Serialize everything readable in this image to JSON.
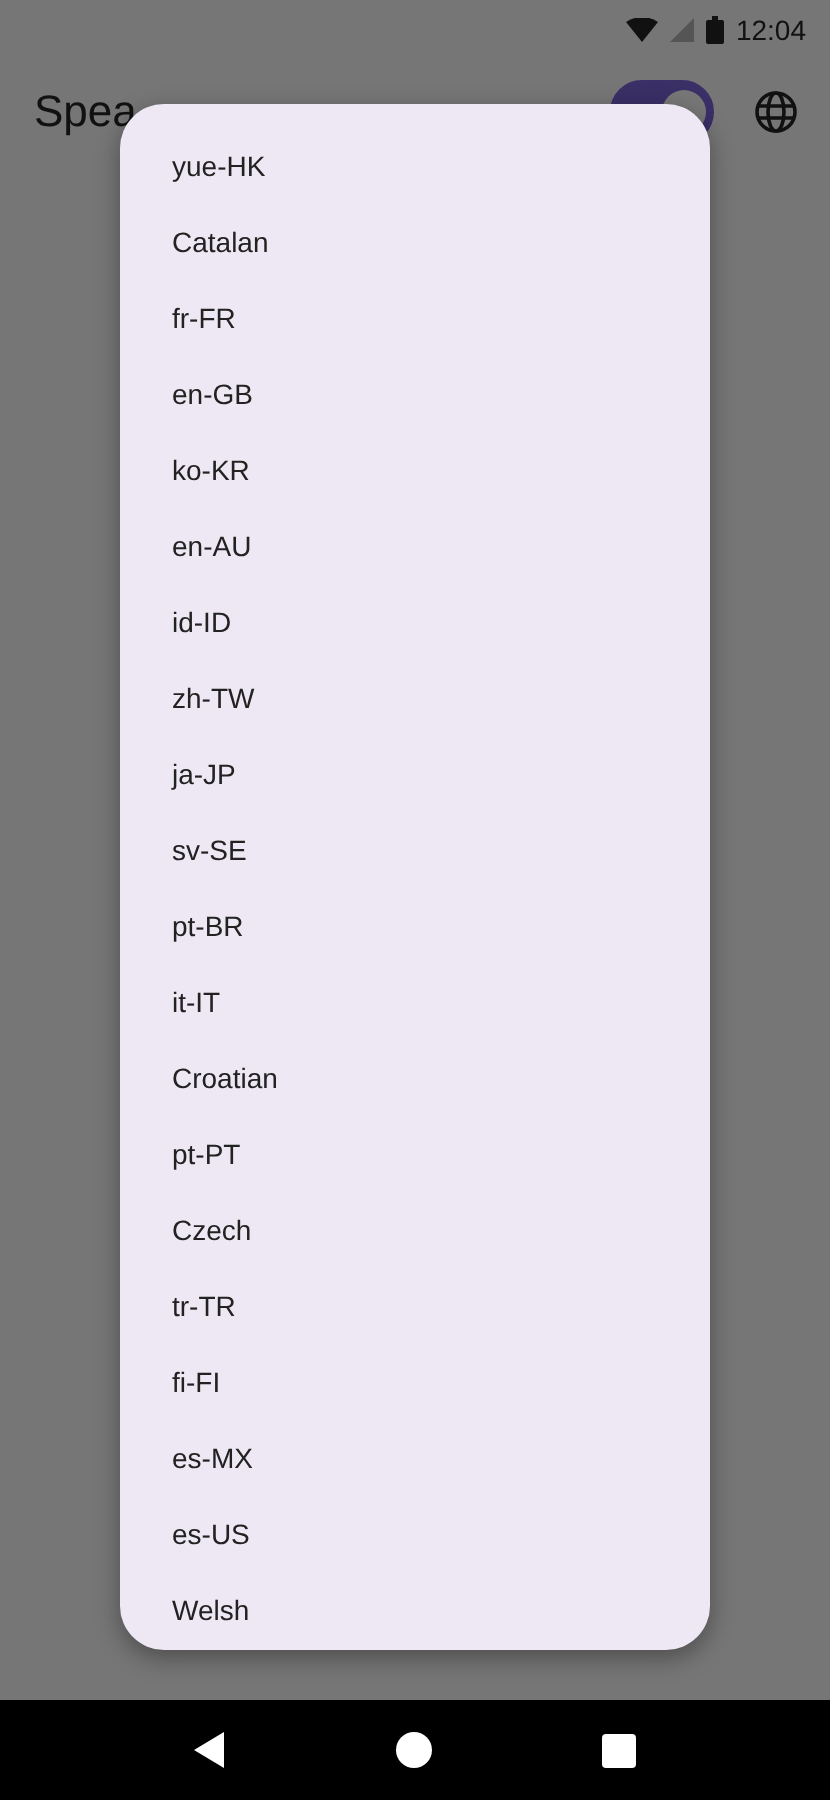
{
  "status_bar": {
    "time": "12:04"
  },
  "app_bar": {
    "title": "Spea",
    "toggle": {
      "on": true
    }
  },
  "menu": {
    "items": [
      {
        "label": "yue-HK"
      },
      {
        "label": "Catalan"
      },
      {
        "label": "fr-FR"
      },
      {
        "label": "en-GB"
      },
      {
        "label": "ko-KR"
      },
      {
        "label": "en-AU"
      },
      {
        "label": "id-ID"
      },
      {
        "label": "zh-TW"
      },
      {
        "label": "ja-JP"
      },
      {
        "label": "sv-SE"
      },
      {
        "label": "pt-BR"
      },
      {
        "label": "it-IT"
      },
      {
        "label": "Croatian"
      },
      {
        "label": "pt-PT"
      },
      {
        "label": "Czech"
      },
      {
        "label": "tr-TR"
      },
      {
        "label": "fi-FI"
      },
      {
        "label": "es-MX"
      },
      {
        "label": "es-US"
      },
      {
        "label": "Welsh"
      }
    ]
  }
}
